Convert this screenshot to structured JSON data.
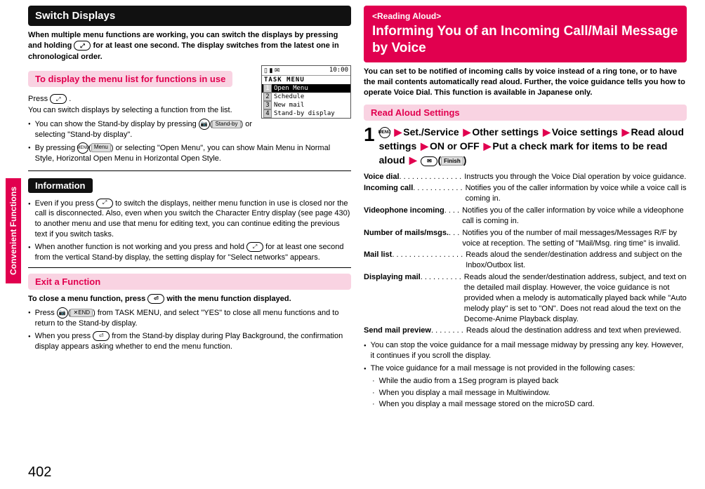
{
  "side_tab": "Convenient Functions",
  "page_number": "402",
  "left": {
    "h1": "Switch Displays",
    "intro": "When multiple menu functions are working, you can switch the displays by pressing and holding ",
    "intro2": " for at least one second. The display switches from the latest one in chronological order.",
    "sub1": "To display the menu list for functions in use",
    "press_line_a": "Press ",
    "press_line_b": ".",
    "press_line2": "You can switch displays by selecting a function from the list.",
    "b1a": "You can show the Stand-by display by pressing ",
    "b1b": " or selecting \"Stand-by display\".",
    "b2a": "By pressing ",
    "b2b": " or selecting \"Open Menu\", you can show Main Menu in Normal Style, Horizontal Open Menu in Horizontal Open Style.",
    "sl_standby": "Stand-by",
    "sl_menu": "Menu",
    "screenshot": {
      "time": "10:00",
      "title": "TASK MENU",
      "items": [
        "Open Menu",
        "Schedule",
        "New mail",
        "Stand-by display"
      ]
    },
    "info_label": "Information",
    "info_b1a": "Even if you press ",
    "info_b1b": " to switch the displays, neither menu function in use is closed nor the call is disconnected. Also, even when you switch the Character Entry display (see page 430) to another menu and use that menu for editing text, you can continue editing the previous text if you switch tasks.",
    "info_b2a": "When another function is not working and you press and hold ",
    "info_b2b": " for at least one second from the vertical Stand-by display, the setting display for \"Select networks\" appears.",
    "sub2": "Exit a Function",
    "exit1a": "To close a menu function, press ",
    "exit1b": " with the menu function displayed.",
    "exit_b1a": "Press ",
    "exit_b1b": " from TASK MENU, and select \"YES\" to close all menu functions and to return to the Stand-by display.",
    "exit_b2a": "When you press ",
    "exit_b2b": " from the Stand-by display during Play Background, the confirmation display appears asking whether to end the menu function.",
    "sl_end": "✕END"
  },
  "right": {
    "pretitle": "<Reading Aloud>",
    "h1": "Informing You of an Incoming Call/Mail Message by Voice",
    "intro": "You can set to be notified of incoming calls by voice instead of a ring tone, or to have the mail contents automatically read aloud. Further, the voice guidance tells you how to operate Voice Dial. This function is available in Japanese only.",
    "sub1": "Read Aloud Settings",
    "step_menu": "MENU",
    "step_parts": [
      "Set./Service",
      "Other settings",
      "Voice settings",
      "Read aloud settings",
      "ON or OFF",
      "Put a check mark for items to be read aloud"
    ],
    "sl_finish": "Finish",
    "dl": [
      {
        "t": "Voice dial",
        "dots": " . . . . . . . . . . . . . . .",
        "d": "Instructs you through the Voice Dial operation by voice guidance."
      },
      {
        "t": "Incoming call",
        "dots": " . . . . . . . . . . . .",
        "d": "Notifies you of the caller information by voice while a voice call is coming in."
      },
      {
        "t": "Videophone incoming",
        "dots": " . . . .",
        "d": "Notifies you of the caller information by voice while a videophone call is coming in."
      },
      {
        "t": "Number of mails/msgs.",
        "dots": " . . .",
        "d": "Notifies you of the number of mail messages/Messages R/F by voice at reception. The setting of \"Mail/Msg. ring time\" is invalid."
      },
      {
        "t": "Mail list",
        "dots": " . . . . . . . . . . . . . . . . .",
        "d": "Reads aloud the sender/destination address and subject on the Inbox/Outbox list."
      },
      {
        "t": "Displaying mail",
        "dots": " . . . . . . . . . .",
        "d": "Reads aloud the sender/destination address, subject, and text on the detailed mail display. However, the voice guidance is not provided when a melody is automatically played back while \"Auto melody play\" is set to \"ON\". Does not read aloud the text on the Decome-Anime Playback display."
      },
      {
        "t": "Send mail preview",
        "dots": ". . . . . . . .",
        "d": "Reads aloud the destination address and text when previewed."
      }
    ],
    "b1": "You can stop the voice guidance for a mail message midway by pressing any key. However, it continues if you scroll the display.",
    "b2": "The voice guidance for a mail message is not provided in the following cases:",
    "cases": [
      "While the audio from a 1Seg program is played back",
      "When you display a mail message in Multiwindow.",
      "When you display a mail message stored on the microSD card."
    ]
  }
}
